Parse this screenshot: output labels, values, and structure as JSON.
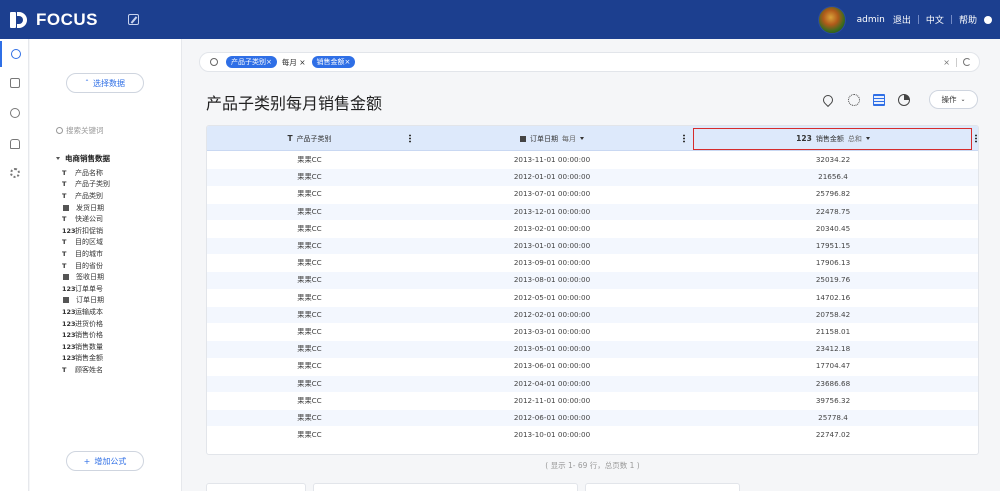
{
  "app": {
    "logo_text": "FOCUS"
  },
  "header": {
    "username": "admin",
    "links": [
      "退出",
      "中文",
      "帮助"
    ]
  },
  "panel": {
    "select_data_label": "选择数据",
    "search_placeholder": "搜索关键词",
    "tree_root": "电商销售数据",
    "fields": [
      {
        "type": "T",
        "label": "产品名称"
      },
      {
        "type": "T",
        "label": "产品子类别"
      },
      {
        "type": "T",
        "label": "产品类别"
      },
      {
        "type": "date",
        "label": "发货日期"
      },
      {
        "type": "T",
        "label": "快递公司"
      },
      {
        "type": "123",
        "label": "折扣促销"
      },
      {
        "type": "T",
        "label": "目的区域"
      },
      {
        "type": "T",
        "label": "目的城市"
      },
      {
        "type": "T",
        "label": "目的省份"
      },
      {
        "type": "date",
        "label": "签收日期"
      },
      {
        "type": "123",
        "label": "订单单号"
      },
      {
        "type": "date",
        "label": "订单日期"
      },
      {
        "type": "123",
        "label": "运输成本"
      },
      {
        "type": "123",
        "label": "进货价格"
      },
      {
        "type": "123",
        "label": "销售价格"
      },
      {
        "type": "123",
        "label": "销售数量"
      },
      {
        "type": "123",
        "label": "销售金额"
      },
      {
        "type": "T",
        "label": "顾客姓名"
      }
    ],
    "add_formula_label": "增加公式"
  },
  "filterbar": {
    "chips": [
      {
        "label": "产品子类别",
        "style": "chip"
      },
      {
        "label": "每月",
        "style": "plain"
      },
      {
        "label": "销售金额",
        "style": "chip"
      }
    ],
    "clear_label": "×"
  },
  "main": {
    "title": "产品子类别每月销售金额",
    "ops_label": "操作"
  },
  "table": {
    "columns": [
      {
        "type": "T",
        "label": "产品子类别",
        "sub": ""
      },
      {
        "type": "date",
        "label": "订单日期",
        "sub": "每月"
      },
      {
        "type": "123",
        "label": "销售金额",
        "sub": "总和"
      }
    ],
    "rows": [
      [
        "果果CC",
        "2013-11-01 00:00:00",
        "32034.22"
      ],
      [
        "果果CC",
        "2012-01-01 00:00:00",
        "21656.4"
      ],
      [
        "果果CC",
        "2013-07-01 00:00:00",
        "25796.82"
      ],
      [
        "果果CC",
        "2013-12-01 00:00:00",
        "22478.75"
      ],
      [
        "果果CC",
        "2013-02-01 00:00:00",
        "20340.45"
      ],
      [
        "果果CC",
        "2013-01-01 00:00:00",
        "17951.15"
      ],
      [
        "果果CC",
        "2013-09-01 00:00:00",
        "17906.13"
      ],
      [
        "果果CC",
        "2013-08-01 00:00:00",
        "25019.76"
      ],
      [
        "果果CC",
        "2012-05-01 00:00:00",
        "14702.16"
      ],
      [
        "果果CC",
        "2012-02-01 00:00:00",
        "20758.42"
      ],
      [
        "果果CC",
        "2013-03-01 00:00:00",
        "21158.01"
      ],
      [
        "果果CC",
        "2013-05-01 00:00:00",
        "23412.18"
      ],
      [
        "果果CC",
        "2013-06-01 00:00:00",
        "17704.47"
      ],
      [
        "果果CC",
        "2012-04-01 00:00:00",
        "23686.68"
      ],
      [
        "果果CC",
        "2012-11-01 00:00:00",
        "39756.32"
      ],
      [
        "果果CC",
        "2012-06-01 00:00:00",
        "25778.4"
      ],
      [
        "果果CC",
        "2013-10-01 00:00:00",
        "22747.02"
      ]
    ],
    "pager_text": "( 显示 1- 69 行，总页数 1 )"
  }
}
